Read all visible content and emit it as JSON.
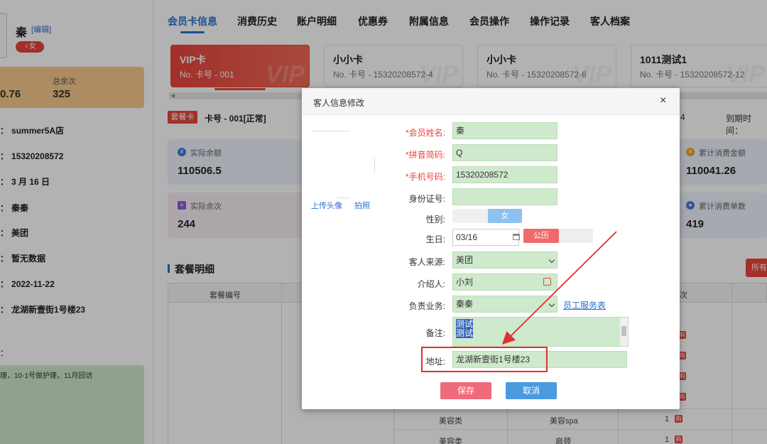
{
  "customer": {
    "name": "秦",
    "edit_label": "[编辑]",
    "gender_badge": "♀女",
    "balance_left": "0.76",
    "remaining_label": "总余次",
    "remaining_value": "325",
    "info": [
      {
        "value": "summer5A店"
      },
      {
        "value": "15320208572"
      },
      {
        "value": "3 月 16 日"
      },
      {
        "value": "秦秦"
      },
      {
        "value": "美团"
      },
      {
        "value": "暂无数据"
      },
      {
        "value": "2022-11-22"
      },
      {
        "value": "龙湖新壹街1号楼23"
      }
    ],
    "note_colon": "：",
    "note": "理，10-1号做护理，11月回访"
  },
  "tabs": [
    "会员卡信息",
    "消费历史",
    "账户明细",
    "优惠券",
    "附属信息",
    "会员操作",
    "操作记录",
    "客人档案"
  ],
  "cards": [
    {
      "title": "VIP卡",
      "no": "No. 卡号 - 001"
    },
    {
      "title": "小小卡",
      "no": "No. 卡号 - 15320208572-4"
    },
    {
      "title": "小小卡",
      "no": "No. 卡号 - 15320208572-6"
    },
    {
      "title": "1011测试1",
      "no": "No. 卡号 - 15320208572-12"
    }
  ],
  "card_watermark": "VIP",
  "package": {
    "badge": "套餐卡",
    "title": "卡号 - 001[正常]",
    "num": "4",
    "expire_label": "到期时间："
  },
  "stats": [
    {
      "label": "实际余额",
      "value": "110506.5",
      "icon": "yen-icon"
    },
    {
      "label": "实际余次",
      "value": "244",
      "icon": "count-icon"
    },
    {
      "label": "累计消费金额",
      "value": "110041.26",
      "icon": "coin-icon"
    },
    {
      "label": "累计消费单数",
      "value": "419",
      "icon": "order-icon"
    }
  ],
  "section": {
    "title": "套餐明细",
    "all_button": "所有"
  },
  "table": {
    "headers": [
      "套餐编号"
    ],
    "partial_header": "次",
    "partial_col_value": "次",
    "rows": [
      {
        "category": "美容类",
        "item": "美容spa",
        "count": "1",
        "buy": "购"
      },
      {
        "category": "美容类",
        "item": "肩颈",
        "count": "1",
        "buy": "购"
      }
    ],
    "buy_marks": [
      "购",
      "购",
      "购",
      "购",
      "购"
    ]
  },
  "modal": {
    "title": "客人信息修改",
    "close_label": "×",
    "upload_label": "上传头像",
    "photo_label": "拍照",
    "fields": {
      "name_label": "会员姓名:",
      "name_value": "秦",
      "pinyin_label": "拼音简码:",
      "pinyin_value": "Q",
      "phone_label": "手机号码:",
      "phone_value": "15320208572",
      "idcard_label": "身份证号:",
      "idcard_value": "",
      "gender_label": "性别:",
      "gender_value": "女",
      "birthday_label": "生日:",
      "birthday_value": "03/16",
      "calendar_type": "公历",
      "source_label": "客人来源:",
      "source_value": "美团",
      "referrer_label": "介绍人:",
      "referrer_value": "小刘",
      "staff_label": "负责业务:",
      "staff_value": "秦秦",
      "staff_link": "员工服务表",
      "remark_label": "备注:",
      "remark_line1": "测试",
      "remark_line2": "测试",
      "address_label": "地址:",
      "address_value": "龙湖新壹街1号楼23"
    },
    "save_label": "保存",
    "cancel_label": "取消"
  },
  "colors": {
    "accent_blue": "#2b6fcf",
    "brand_red": "#e8453c",
    "field_green": "#cfe9cc",
    "annotation_red": "#e03030"
  }
}
